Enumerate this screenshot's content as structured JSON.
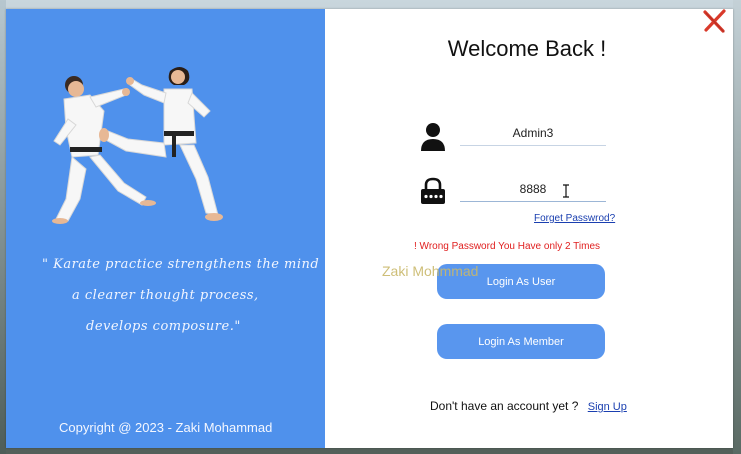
{
  "window": {
    "title": "Welcome Back !"
  },
  "left_panel": {
    "quote_lines": [
      "\" Karate practice strengthens the mind",
      "a clearer thought process,",
      "develops composure.\""
    ],
    "copyright": "Copyright @ 2023 - Zaki  Mohammad",
    "background_color": "#4f91ec"
  },
  "form": {
    "username_value": "Admin3",
    "password_value": "8888",
    "forget_password": "Forget Passwrod?",
    "error_message": "! Wrong Password You Have only 2 Times",
    "login_user_label": "Login As User",
    "login_member_label": "Login As Member",
    "signup_prompt": "Don't have an account yet ?",
    "signup_link": "Sign Up"
  },
  "overlay": {
    "watermark": "Zaki Mohmmad"
  },
  "icons": {
    "close": "close-icon",
    "user": "user-icon",
    "lock": "lock-icon",
    "text_cursor": "text-cursor-icon"
  },
  "colors": {
    "accent": "#5996ee",
    "error": "#e02020",
    "link": "#1a3fb0",
    "close": "#d93a2b"
  }
}
